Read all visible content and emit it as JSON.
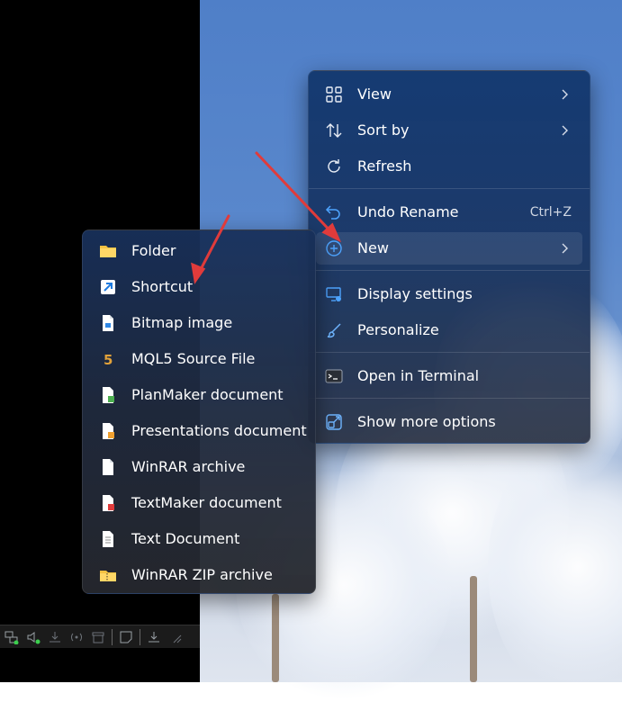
{
  "context_menu": {
    "items": [
      {
        "label": "View",
        "icon": "grid-icon",
        "has_submenu": true
      },
      {
        "label": "Sort by",
        "icon": "sort-icon",
        "has_submenu": true
      },
      {
        "label": "Refresh",
        "icon": "refresh-icon"
      },
      {
        "label": "Undo Rename",
        "icon": "undo-icon",
        "shortcut": "Ctrl+Z"
      },
      {
        "label": "New",
        "icon": "plus-circle-icon",
        "has_submenu": true,
        "active": true
      },
      {
        "label": "Display settings",
        "icon": "display-settings-icon"
      },
      {
        "label": "Personalize",
        "icon": "brush-icon"
      },
      {
        "label": "Open in Terminal",
        "icon": "terminal-icon"
      },
      {
        "label": "Show more options",
        "icon": "expand-icon"
      }
    ]
  },
  "new_submenu": {
    "items": [
      {
        "label": "Folder",
        "icon": "folder-icon"
      },
      {
        "label": "Shortcut",
        "icon": "shortcut-icon"
      },
      {
        "label": "Bitmap image",
        "icon": "bitmap-file-icon"
      },
      {
        "label": "MQL5 Source File",
        "icon": "mql5-file-icon",
        "glyph": "5"
      },
      {
        "label": "PlanMaker document",
        "icon": "planmaker-file-icon"
      },
      {
        "label": "Presentations document",
        "icon": "presentations-file-icon"
      },
      {
        "label": "WinRAR archive",
        "icon": "blank-file-icon"
      },
      {
        "label": "TextMaker document",
        "icon": "textmaker-file-icon"
      },
      {
        "label": "Text Document",
        "icon": "text-file-icon"
      },
      {
        "label": "WinRAR ZIP archive",
        "icon": "zip-folder-icon"
      }
    ]
  },
  "colors": {
    "accent": "#4ea4ff",
    "annotation_arrow": "#e03b3b",
    "folder": "#f5c242"
  }
}
